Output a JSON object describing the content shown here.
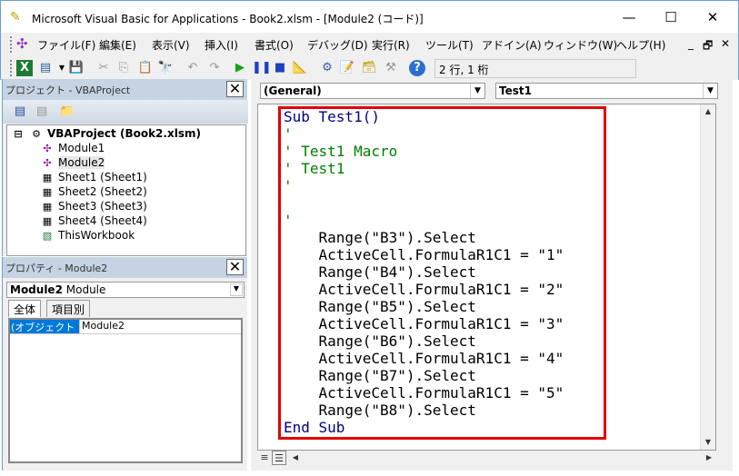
{
  "window": {
    "title": "Microsoft Visual Basic for Applications - Book2.xlsm - [Module2 (コード)]",
    "minimize": "—",
    "maximize": "☐",
    "close": "✕"
  },
  "menu": [
    "ファイル(F)",
    "編集(E)",
    "表示(V)",
    "挿入(I)",
    "書式(O)",
    "デバッグ(D)",
    "実行(R)",
    "ツール(T)",
    "アドイン(A)",
    "ウィンドウ(W)",
    "ヘルプ(H)"
  ],
  "menu_controls": {
    "min": "_",
    "restore": "🗗",
    "close": "✕"
  },
  "toolbar": {
    "status": "2 行, 1 桁"
  },
  "project": {
    "title": "プロジェクト - VBAProject",
    "close": "✕",
    "root": "VBAProject (Book2.xlsm)",
    "items": [
      "Module1",
      "Module2",
      "Sheet1 (Sheet1)",
      "Sheet2 (Sheet2)",
      "Sheet3 (Sheet3)",
      "Sheet4 (Sheet4)",
      "ThisWorkbook"
    ]
  },
  "properties": {
    "title": "プロパティ - Module2",
    "close": "✕",
    "object_name": "Module2",
    "object_type": "Module",
    "tabs": [
      "全体",
      "項目別"
    ],
    "rows": [
      {
        "name": "(オブジェクト名)",
        "value": "Module2"
      }
    ]
  },
  "code": {
    "object_combo": "(General)",
    "proc_combo": "Test1",
    "lines": [
      {
        "t": "Sub Test1()",
        "c": "kw"
      },
      {
        "t": "'",
        "c": "cm"
      },
      {
        "t": "' Test1 Macro",
        "c": "cm"
      },
      {
        "t": "' Test1",
        "c": "cm"
      },
      {
        "t": "'",
        "c": "cm"
      },
      {
        "t": "",
        "c": ""
      },
      {
        "t": "'",
        "c": "cm"
      },
      {
        "t": "    Range(\"B3\").Select",
        "c": ""
      },
      {
        "t": "    ActiveCell.FormulaR1C1 = \"1\"",
        "c": ""
      },
      {
        "t": "    Range(\"B4\").Select",
        "c": ""
      },
      {
        "t": "    ActiveCell.FormulaR1C1 = \"2\"",
        "c": ""
      },
      {
        "t": "    Range(\"B5\").Select",
        "c": ""
      },
      {
        "t": "    ActiveCell.FormulaR1C1 = \"3\"",
        "c": ""
      },
      {
        "t": "    Range(\"B6\").Select",
        "c": ""
      },
      {
        "t": "    ActiveCell.FormulaR1C1 = \"4\"",
        "c": ""
      },
      {
        "t": "    Range(\"B7\").Select",
        "c": ""
      },
      {
        "t": "    ActiveCell.FormulaR1C1 = \"5\"",
        "c": ""
      },
      {
        "t": "    Range(\"B8\").Select",
        "c": ""
      },
      {
        "t": "End Sub",
        "c": "kw"
      }
    ]
  },
  "colors": {
    "highlight": "#e00000",
    "keyword": "#00008b",
    "comment": "#008000",
    "selection": "#0078d7"
  }
}
